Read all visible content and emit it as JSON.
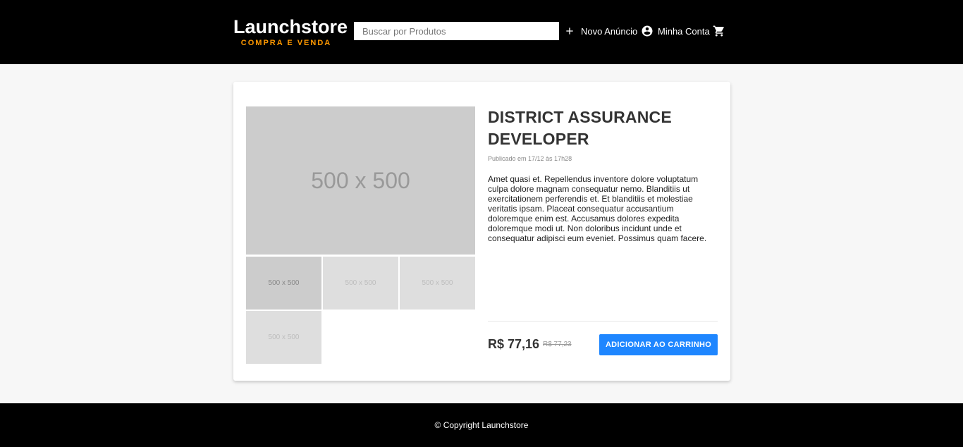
{
  "header": {
    "logo_title": "Launchstore",
    "logo_subtitle": "COMPRA E VENDA",
    "search_placeholder": "Buscar por Produtos",
    "nav": {
      "new_ad_label": "Novo Anúncio",
      "new_ad_icon": "plus-icon",
      "account_label": "Minha Conta",
      "account_icon": "account-circle-icon",
      "cart_icon": "shopping-cart-icon"
    }
  },
  "product": {
    "main_image_label": "500 x 500",
    "thumbnails": [
      {
        "label": "500 x 500",
        "active": true
      },
      {
        "label": "500 x 500",
        "active": false
      },
      {
        "label": "500 x 500",
        "active": false
      },
      {
        "label": "500 x 500",
        "active": false
      }
    ],
    "title": "DISTRICT ASSURANCE DEVELOPER",
    "published": "Publicado em 17/12 às 17h28",
    "description": "Amet quasi et. Repellendus inventore dolore voluptatum culpa dolore magnam consequatur nemo. Blanditiis ut exercitationem perferendis et. Et blanditiis et molestiae veritatis ipsam. Placeat consequatur accusantium doloremque enim est. Accusamus dolores expedita doloremque modi ut. Non doloribus incidunt unde et consequatur adipisci eum eveniet. Possimus quam facere.",
    "price": "R$ 77,16",
    "old_price": "R$ 77,23",
    "add_to_cart_label": "ADICIONAR AO CARRINHO"
  },
  "footer": {
    "copyright": "© Copyright Launchstore"
  },
  "colors": {
    "header_bg": "#000000",
    "accent_orange": "#ff9900",
    "button_blue": "#1e86ff"
  }
}
